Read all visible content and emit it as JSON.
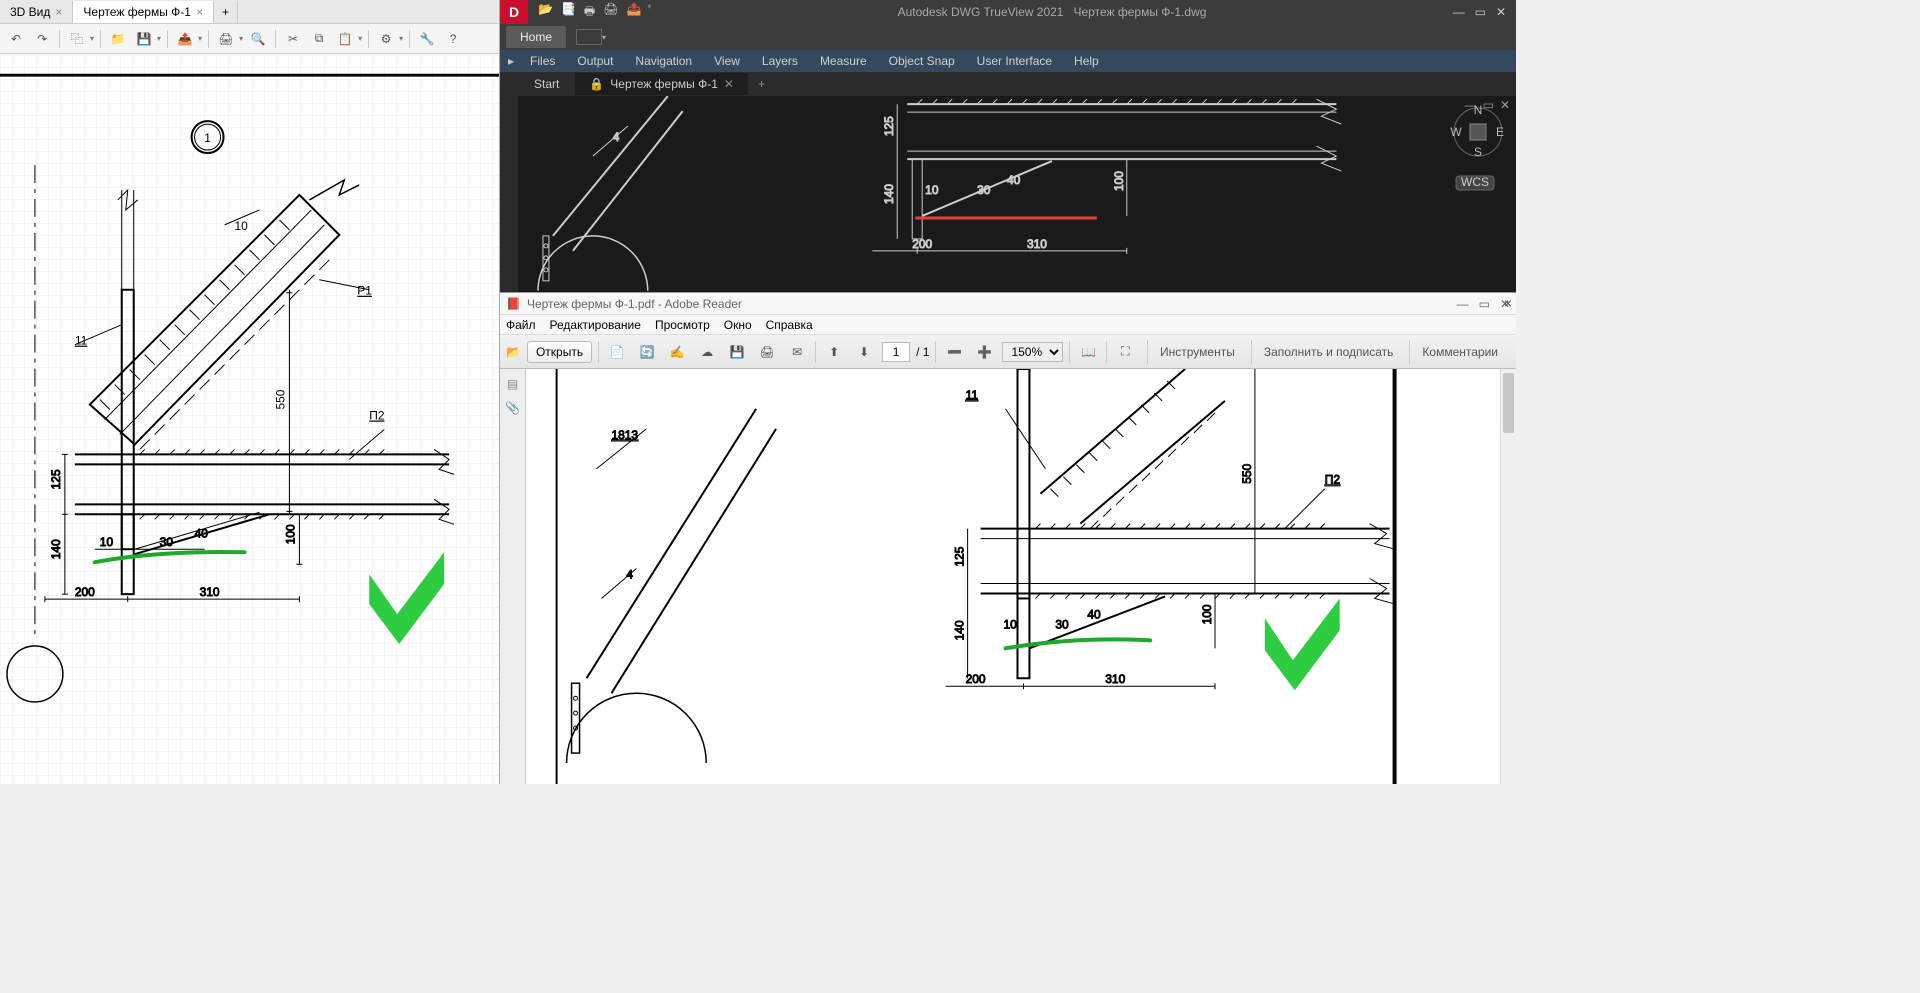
{
  "leftApp": {
    "tabs": [
      {
        "label": "3D Вид"
      },
      {
        "label": "Чертеж фермы Ф-1"
      }
    ],
    "drawing": {
      "bubble": "1",
      "dims": {
        "d550": "550",
        "d125": "125",
        "d140": "140",
        "d100": "100",
        "d10l": "10",
        "d10s": "10",
        "d30": "30",
        "d40": "40",
        "d200": "200",
        "d310": "310",
        "d11": "11"
      },
      "labels": {
        "p1": "P1",
        "p2": "П2"
      }
    }
  },
  "trueview": {
    "appTitle": "Autodesk DWG TrueView 2021",
    "docTitle": "Чертеж фермы Ф-1.dwg",
    "ribbonHome": "Home",
    "menus": [
      "Files",
      "Output",
      "Navigation",
      "View",
      "Layers",
      "Measure",
      "Object Snap",
      "User Interface",
      "Help"
    ],
    "tabs": {
      "start": "Start",
      "doc": "Чертеж фермы Ф-1"
    },
    "wcs": "WCS",
    "compass": {
      "n": "N",
      "s": "S",
      "e": "E",
      "w": "W"
    },
    "drawing": {
      "d4": "4",
      "d125": "125",
      "d140": "140",
      "d10": "10",
      "d30": "30",
      "d40": "40",
      "d100": "100",
      "d200": "200",
      "d310": "310"
    }
  },
  "reader": {
    "title": "Чертеж фермы Ф-1.pdf - Adobe Reader",
    "menus": [
      "Файл",
      "Редактирование",
      "Просмотр",
      "Окно",
      "Справка"
    ],
    "open": "Открыть",
    "page": "1",
    "pages": "/ 1",
    "zoom": "150%",
    "panels": {
      "tools": "Инструменты",
      "fill": "Заполнить и подписать",
      "comments": "Комментарии"
    },
    "drawing": {
      "d1813": "1813",
      "d4": "4",
      "d11": "11",
      "d550": "550",
      "p2": "П2",
      "d125": "125",
      "d140": "140",
      "d10": "10",
      "d30": "30",
      "d40": "40",
      "d100": "100",
      "d200": "200",
      "d310": "310"
    }
  }
}
